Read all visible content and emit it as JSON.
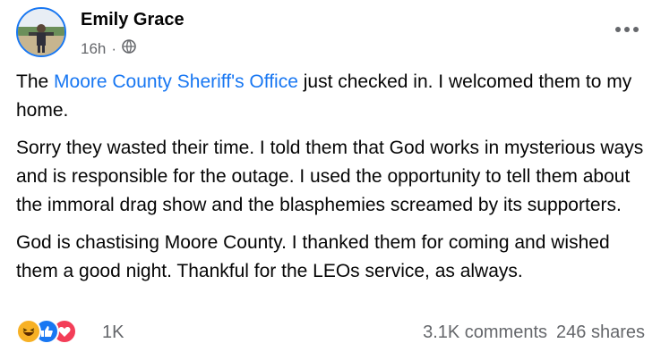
{
  "post": {
    "author": "Emily Grace",
    "time": "16h",
    "separator": "·",
    "privacy_icon": "globe-icon",
    "more_icon": "more-options-icon",
    "paragraph1": {
      "prefix": "The ",
      "link": "Moore County Sheriff's Office",
      "suffix": " just checked in. I welcomed them to my home."
    },
    "paragraph2": "Sorry they wasted their time. I told them that God works in mysterious ways and is responsible for the outage. I used the opportunity to tell them about the immoral drag show and the blasphemies screamed by its supporters.",
    "paragraph3": "God is chastising Moore County. I thanked them for coming and wished them a good night. Thankful for the LEOs service, as always."
  },
  "footer": {
    "reaction_icons": [
      "haha-icon",
      "like-icon",
      "love-icon"
    ],
    "reaction_count": "1K",
    "comments": "3.1K comments",
    "shares": "246 shares"
  },
  "colors": {
    "link": "#1877f2",
    "secondary_text": "#65676b",
    "like": "#1877f2",
    "love": "#f33e58",
    "haha": "#f7b125"
  }
}
